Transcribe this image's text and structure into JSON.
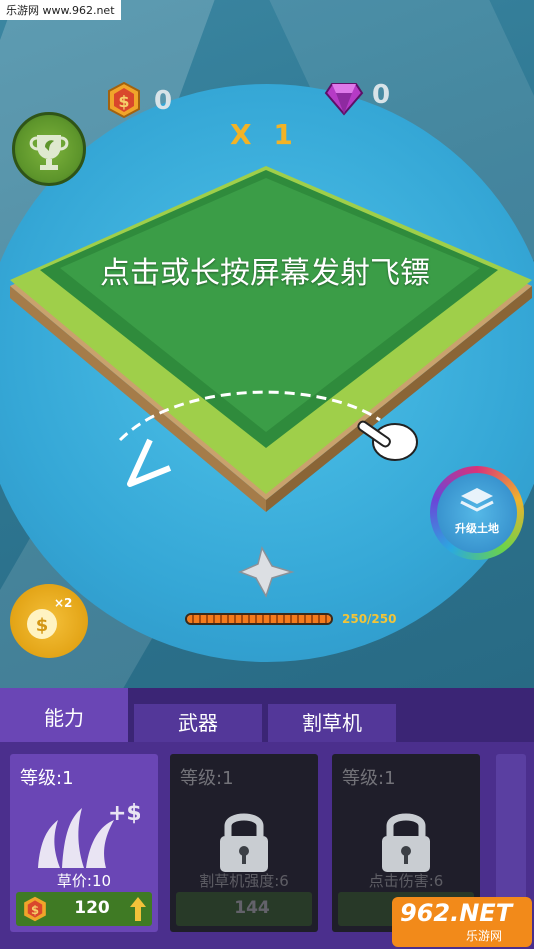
{
  "watermark": "乐游网 www.962.net",
  "currency": {
    "coins": "0",
    "gems": "0"
  },
  "multiplier": "X 1",
  "tip": "点击或长按屏幕发射飞镖",
  "upgrade_land_label": "升级土地",
  "coin_boost": {
    "badge": "×2"
  },
  "progress": {
    "current": 250,
    "max": 250,
    "label": "250/250"
  },
  "tabs": [
    {
      "label": "能力",
      "active": true
    },
    {
      "label": "武器",
      "active": false
    },
    {
      "label": "割草机",
      "active": false
    }
  ],
  "cards": [
    {
      "level": "等级:1",
      "caption": "草价:10",
      "price": "120",
      "locked": false
    },
    {
      "level": "等级:1",
      "caption": "割草机强度:6",
      "price": "144",
      "locked": true
    },
    {
      "level": "等级:1",
      "caption": "点击伤害:6",
      "price": "",
      "locked": true
    }
  ],
  "logo": {
    "text": "962.NET",
    "sub": "乐游网"
  },
  "colors": {
    "accent": "#f2b326",
    "panel": "#4b2f8d",
    "tab_active": "#6a46b5"
  }
}
